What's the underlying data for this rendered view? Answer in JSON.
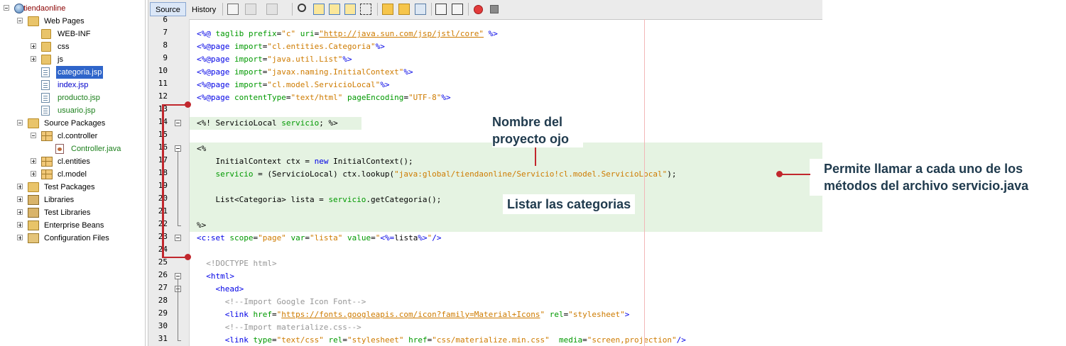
{
  "project_tree": {
    "root": "tiendaonline",
    "web_pages": "Web Pages",
    "web_inf": "WEB-INF",
    "css": "css",
    "js": "js",
    "files": [
      "categoria.jsp",
      "index.jsp",
      "producto.jsp",
      "usuario.jsp"
    ],
    "source_packages": "Source Packages",
    "controller_pkg": "cl.controller",
    "controller_file": "Controller.java",
    "entities_pkg": "cl.entities",
    "model_pkg": "cl.model",
    "test_packages": "Test Packages",
    "libraries": "Libraries",
    "test_libraries": "Test Libraries",
    "enterprise_beans": "Enterprise Beans",
    "configuration_files": "Configuration Files"
  },
  "editor": {
    "tabs": [
      "Source",
      "History"
    ],
    "line_numbers": [
      "6",
      "7",
      "8",
      "9",
      "10",
      "11",
      "12",
      "13",
      "14",
      "15",
      "16",
      "17",
      "18",
      "19",
      "20",
      "21",
      "22",
      "23",
      "24",
      "25",
      "26",
      "27",
      "28",
      "29",
      "30",
      "31"
    ],
    "lines": {
      "l7": [
        "<%@ ",
        "taglib ",
        "prefix",
        "=",
        "\"c\"",
        " ",
        "uri",
        "=",
        "\"http://java.sun.com/jsp/jstl/core\"",
        " %>"
      ],
      "l8": [
        "<%@page ",
        "import",
        "=",
        "\"cl.entities.Categoria\"",
        "%>"
      ],
      "l9": [
        "<%@page ",
        "import",
        "=",
        "\"java.util.List\"",
        "%>"
      ],
      "l10": [
        "<%@page ",
        "import",
        "=",
        "\"javax.naming.InitialContext\"",
        "%>"
      ],
      "l11": [
        "<%@page ",
        "import",
        "=",
        "\"cl.model.ServicioLocal\"",
        "%>"
      ],
      "l12": [
        "<%@page ",
        "contentType",
        "=",
        "\"text/html\"",
        " ",
        "pageEncoding",
        "=",
        "\"UTF-8\"",
        "%>"
      ],
      "l14": [
        "<%! ServicioLocal ",
        "servicio",
        "; %>"
      ],
      "l16": [
        "<%"
      ],
      "l17": [
        "    InitialContext ctx = ",
        "new",
        " InitialContext();"
      ],
      "l18": [
        "    ",
        "servicio",
        " = (ServicioLocal) ctx.lookup(",
        "\"java:global/tiendaonline/Servicio!cl.model.ServicioLocal\"",
        ");"
      ],
      "l20": [
        "    List<Categoria> lista = ",
        "servicio",
        ".getCategoria();"
      ],
      "l22": [
        "%>"
      ],
      "l23": [
        "<c:set ",
        "scope",
        "=",
        "\"page\"",
        " ",
        "var",
        "=",
        "\"lista\"",
        " ",
        "value",
        "=",
        "\"",
        "<%=",
        "lista",
        "%>",
        "\"",
        "/>"
      ],
      "l25": [
        "  <!DOCTYPE html>"
      ],
      "l26": [
        "  <html>"
      ],
      "l27": [
        "    <head>"
      ],
      "l28": [
        "      <!--Import Google Icon Font-->"
      ],
      "l29": [
        "      <link ",
        "href",
        "=",
        "\"",
        "https://fonts.googleapis.com/icon?family=Material+Icons",
        "\"",
        " ",
        "rel",
        "=",
        "\"stylesheet\"",
        ">"
      ],
      "l30": [
        "      <!--Import materialize.css-->"
      ],
      "l31": [
        "      <link ",
        "type",
        "=",
        "\"text/css\"",
        " ",
        "rel",
        "=",
        "\"stylesheet\"",
        " ",
        "href",
        "=",
        "\"css/materialize.min.css\"",
        "  ",
        "media",
        "=",
        "\"screen,projection\"",
        "/>"
      ]
    }
  },
  "annotations": {
    "project_name": [
      "Nombre del",
      "proyecto ojo"
    ],
    "list_categories": "Listar las categorias",
    "call_methods": [
      "Permite llamar a cada uno de los",
      "métodos del archivo servicio.java"
    ]
  },
  "colors": {
    "annotation_red": "#c1272d",
    "annotation_text": "#1f3a4d",
    "highlight_green": "#e5f3e2",
    "selection_blue": "#2f65ca"
  }
}
